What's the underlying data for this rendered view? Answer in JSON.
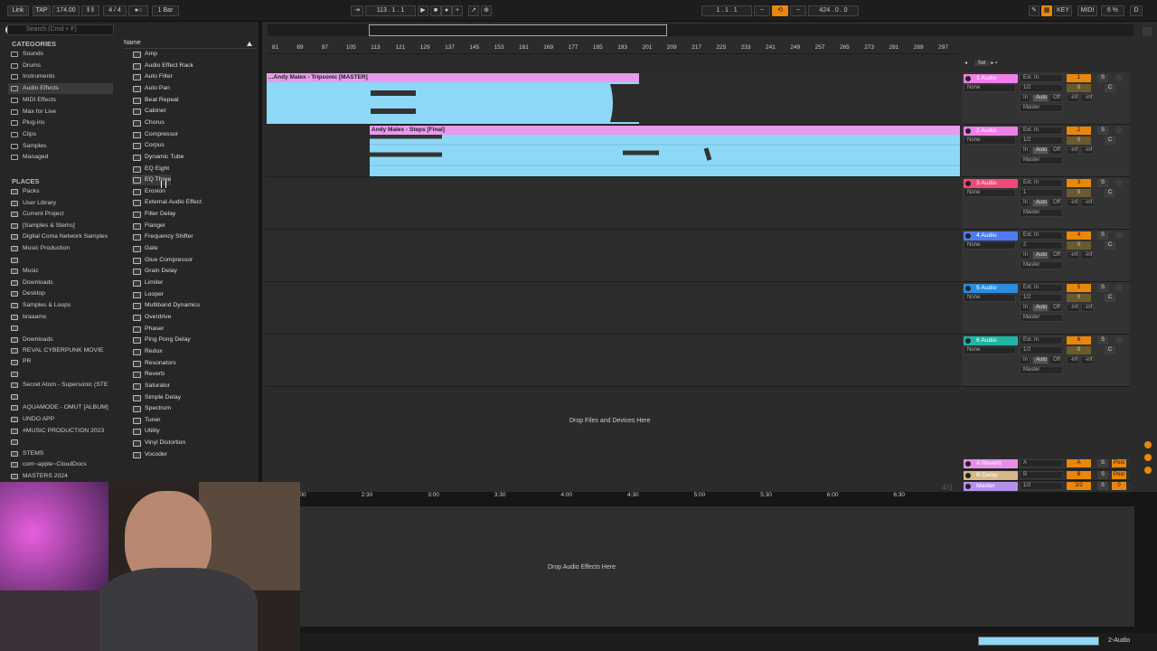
{
  "transport": {
    "link": "Link",
    "tap": "TAP",
    "tempo": "174.00",
    "meter": "4 / 4",
    "quant": "1 Bar",
    "position": "113 . 1 . 1",
    "loop_start": "1 . 1 . 1",
    "loop_len": "424 . 0 . 0",
    "key": "KEY",
    "midi": "MIDI",
    "cpu": "6 %",
    "d": "D"
  },
  "browser": {
    "search_placeholder": "Search (Cmd + F)",
    "categories_title": "CATEGORIES",
    "categories": [
      "Sounds",
      "Drums",
      "Instruments",
      "Audio Effects",
      "MIDI Effects",
      "Max for Live",
      "Plug-ins",
      "Clips",
      "Samples",
      "Managed"
    ],
    "places_title": "PLACES",
    "places": [
      "Packs",
      "User Library",
      "Current Project",
      "[Samples & Stems]",
      "Digital Coma Network Samples",
      "Music Production",
      "",
      "Music",
      "Downloads",
      "Desktop",
      "Samples & Loops",
      "braaams",
      "",
      "Downloads",
      "REVAL CYBERPUNK MOVIE PR",
      "",
      "",
      "Secret Atom - Supersonic (STE",
      "",
      "AQUAMODE - OMUT [ALBUM]",
      "UNDO APP",
      "#MUSIC PRODUCTION 2023",
      "",
      "STEMS",
      "com~apple~CloudDocs",
      "MASTERS 2024"
    ],
    "name_header": "Name",
    "devices": [
      "Amp",
      "Audio Effect Rack",
      "Auto Filter",
      "Auto Pan",
      "Beat Repeat",
      "Cabinet",
      "Chorus",
      "Compressor",
      "Corpus",
      "Dynamic Tube",
      "EQ Eight",
      "EQ Three",
      "Erosion",
      "External Audio Effect",
      "Filter Delay",
      "Flanger",
      "Frequency Shifter",
      "Gate",
      "Glue Compressor",
      "Grain Delay",
      "Limiter",
      "Looper",
      "Multiband Dynamics",
      "Overdrive",
      "Phaser",
      "Ping Pong Delay",
      "Redux",
      "Resonators",
      "Reverb",
      "Saturator",
      "Simple Delay",
      "Spectrum",
      "Tuner",
      "Utility",
      "Vinyl Distortion",
      "Vocoder"
    ]
  },
  "ruler": [
    "81",
    "89",
    "97",
    "105",
    "113",
    "121",
    "129",
    "137",
    "145",
    "153",
    "161",
    "169",
    "177",
    "185",
    "193",
    "201",
    "209",
    "217",
    "225",
    "233",
    "241",
    "249",
    "257",
    "265",
    "273",
    "281",
    "289",
    "297"
  ],
  "clips": [
    {
      "name": "...Andy Malex - Tripsonic [MASTER]"
    },
    {
      "name": "Andy Malex - Steps [Final]"
    }
  ],
  "set_label": "Set",
  "tracks": [
    {
      "name": "1 Audio",
      "color": "#ef7fe9",
      "input": "Ext. In",
      "route": "None",
      "ch": "1/2",
      "out": "Master",
      "num": "1"
    },
    {
      "name": "2 Audio",
      "color": "#ef7fe9",
      "input": "Ext. In",
      "route": "None",
      "ch": "1/2",
      "out": "Master",
      "num": "2"
    },
    {
      "name": "3 Audio",
      "color": "#f04a7a",
      "input": "Ext. In",
      "route": "None",
      "ch": "1",
      "out": "Master",
      "num": "3"
    },
    {
      "name": "4 Audio",
      "color": "#4d7cf0",
      "input": "Ext. In",
      "route": "None",
      "ch": "2",
      "out": "Master",
      "num": "4"
    },
    {
      "name": "5 Audio",
      "color": "#2a8de0",
      "input": "Ext. In",
      "route": "None",
      "ch": "1/2",
      "out": "Master",
      "num": "5"
    },
    {
      "name": "6 Audio",
      "color": "#1fb6a4",
      "input": "Ext. In",
      "route": "None",
      "ch": "1/2",
      "out": "Master",
      "num": "6"
    }
  ],
  "track_labels": {
    "in": "In",
    "auto": "Auto",
    "off": "Off",
    "inf": "-inf",
    "s": "S",
    "c": "C",
    "zero": "0"
  },
  "drop_files": "Drop Files and Devices Here",
  "returns": [
    {
      "name": "A Reverb",
      "color": "#e88ee8",
      "letter": "A",
      "post": "Post"
    },
    {
      "name": "B Delay",
      "color": "#d6b98a",
      "letter": "B",
      "post": "Post"
    },
    {
      "name": "Master",
      "color": "#b690ee",
      "letter": "1/2",
      "post": "0"
    }
  ],
  "time_ruler": [
    "2:00",
    "2:30",
    "3:00",
    "3:30",
    "4:00",
    "4:30",
    "5:00",
    "5:30",
    "6:00",
    "6:30"
  ],
  "time_sig": "4/1",
  "drop_audio_effects": "Drop Audio Effects Here",
  "status_track": "2-Audio"
}
